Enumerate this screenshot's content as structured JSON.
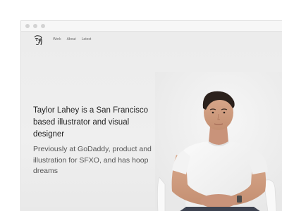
{
  "nav": {
    "items": [
      {
        "label": "Work"
      },
      {
        "label": "About"
      },
      {
        "label": "Latest"
      }
    ]
  },
  "hero": {
    "headline": "Taylor Lahey is a San Francisco based illustrator and visual designer",
    "subline": "Previously at GoDaddy, product and illustration for SFXO, and has hoop dreams"
  },
  "icons": {
    "logo": "face-sketch-icon"
  },
  "colors": {
    "page_background": "#efefef",
    "headline_text": "#222222",
    "subline_text": "#555555",
    "nav_text": "#6b6b6b"
  }
}
